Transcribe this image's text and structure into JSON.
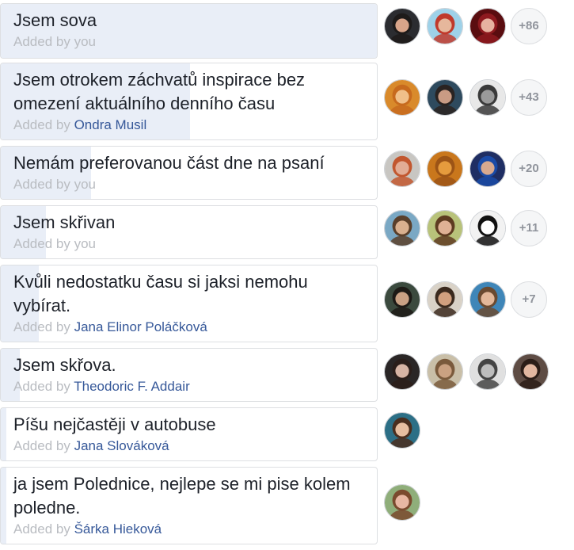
{
  "poll": {
    "options": [
      {
        "title": "Jsem sova",
        "added_label": "Added by",
        "added_by": "you",
        "self": true,
        "fill_fraction": 1.0,
        "voters": [
          {
            "icon": "avatar-photo",
            "bg": "#2b2c30",
            "skin": "#d9a58a",
            "hair": "#1e1b1a"
          },
          {
            "icon": "avatar-photo",
            "bg": "#9ed1e8",
            "skin": "#e6b79c",
            "hair": "#c0392b"
          },
          {
            "icon": "avatar-photo",
            "bg": "#5a0d10",
            "skin": "#e7b2a0",
            "hair": "#8e1a1f"
          }
        ],
        "more": "+86"
      },
      {
        "title": "Jsem otrokem záchvatů inspirace bez omezení aktuálního denního času",
        "added_label": "Added by",
        "added_by": "Ondra Musil",
        "self": false,
        "fill_fraction": 0.5,
        "voters": [
          {
            "icon": "avatar-photo",
            "bg": "#d98a2b",
            "skin": "#f0c08a",
            "hair": "#c76a1e"
          },
          {
            "icon": "avatar-photo",
            "bg": "#2e4a5e",
            "skin": "#c99b84",
            "hair": "#2a2321"
          },
          {
            "icon": "avatar-photo",
            "bg": "#e8e8e8",
            "skin": "#9a9a9a",
            "hair": "#3a3a3a"
          }
        ],
        "more": "+43"
      },
      {
        "title": "Nemám preferovanou část dne na psaní",
        "added_label": "Added by",
        "added_by": "you",
        "self": true,
        "fill_fraction": 0.24,
        "voters": [
          {
            "icon": "avatar-photo",
            "bg": "#c8c6c2",
            "skin": "#e2ac95",
            "hair": "#c2572f"
          },
          {
            "icon": "avatar-photo",
            "bg": "#c9771c",
            "skin": "#e59b3d",
            "hair": "#9c5416"
          },
          {
            "icon": "avatar-photo",
            "bg": "#1f2e63",
            "skin": "#d8a98f",
            "hair": "#1a4aa6"
          }
        ],
        "more": "+20"
      },
      {
        "title": "Jsem skřivan",
        "added_label": "Added by",
        "added_by": "you",
        "self": true,
        "fill_fraction": 0.12,
        "voters": [
          {
            "icon": "avatar-photo",
            "bg": "#7aa8c4",
            "skin": "#d9b08f",
            "hair": "#5a3f2a"
          },
          {
            "icon": "avatar-photo",
            "bg": "#b8c27a",
            "skin": "#dfb195",
            "hair": "#5e3b21"
          },
          {
            "icon": "avatar-photo",
            "bg": "#f2f2f2",
            "skin": "#ffffff",
            "hair": "#111111"
          }
        ],
        "more": "+11"
      },
      {
        "title": "Kvůli nedostatku času si jaksi nemohu vybírat.",
        "added_label": "Added by",
        "added_by": "Jana Elinor Poláčková",
        "self": false,
        "fill_fraction": 0.1,
        "voters": [
          {
            "icon": "avatar-photo",
            "bg": "#3b4a3e",
            "skin": "#c9a184",
            "hair": "#1d1a16"
          },
          {
            "icon": "avatar-photo",
            "bg": "#d9d2c7",
            "skin": "#d1a07f",
            "hair": "#3b2a1e"
          },
          {
            "icon": "avatar-photo",
            "bg": "#3f86b8",
            "skin": "#e3b89a",
            "hair": "#6a4a30"
          }
        ],
        "more": "+7"
      },
      {
        "title": "Jsem skřova.",
        "added_label": "Added by",
        "added_by": "Theodoric F. Addair",
        "self": false,
        "fill_fraction": 0.05,
        "voters": [
          {
            "icon": "avatar-photo",
            "bg": "#2a2626",
            "skin": "#d7b4a4",
            "hair": "#2b1e1a"
          },
          {
            "icon": "avatar-photo",
            "bg": "#c9bfa8",
            "skin": "#caa181",
            "hair": "#7a5a3c"
          },
          {
            "icon": "avatar-photo",
            "bg": "#e0e0e0",
            "skin": "#bdbdbd",
            "hair": "#444444"
          },
          {
            "icon": "avatar-photo",
            "bg": "#5e4c44",
            "skin": "#e2b7a0",
            "hair": "#2b1d17"
          }
        ],
        "more": ""
      },
      {
        "title": "Píšu nejčastěji v autobuse",
        "added_label": "Added by",
        "added_by": "Jana Slováková",
        "self": false,
        "fill_fraction": 0.015,
        "voters": [
          {
            "icon": "avatar-photo",
            "bg": "#2c6f86",
            "skin": "#e6bea0",
            "hair": "#4a2e1e"
          }
        ],
        "more": ""
      },
      {
        "title": "ja jsem Polednice, nejlepe se mi pise kolem poledne.",
        "added_label": "Added by",
        "added_by": "Šárka Hieková",
        "self": false,
        "fill_fraction": 0.015,
        "voters": [
          {
            "icon": "avatar-photo",
            "bg": "#8fae7a",
            "skin": "#e8b7a3",
            "hair": "#7a4a2e"
          }
        ],
        "more": ""
      }
    ]
  }
}
